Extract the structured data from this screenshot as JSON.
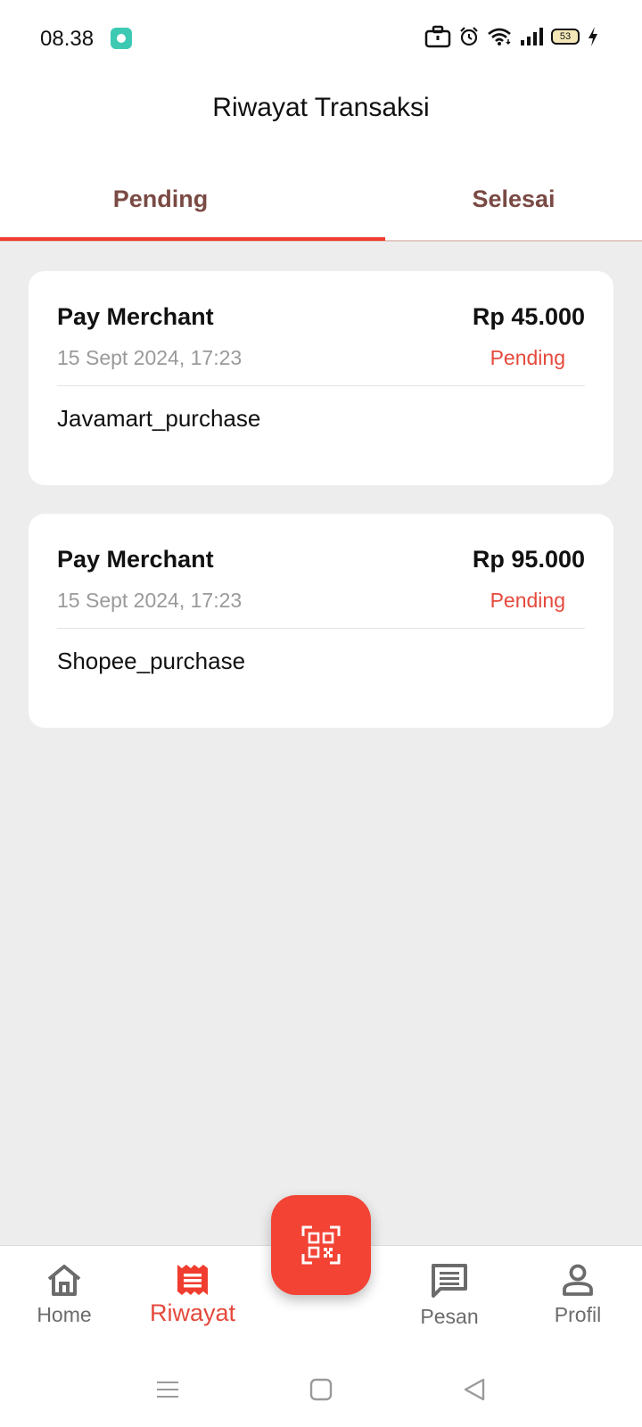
{
  "status_bar": {
    "time": "08.38",
    "battery_level": "53",
    "icons": [
      "app-notification-icon",
      "briefcase-icon",
      "alarm-icon",
      "wifi-icon",
      "signal-icon",
      "battery-icon",
      "charging-icon"
    ]
  },
  "header": {
    "title": "Riwayat Transaksi"
  },
  "tabs": [
    {
      "label": "Pending",
      "active": true
    },
    {
      "label": "Selesai",
      "active": false
    }
  ],
  "transactions": [
    {
      "title": "Pay Merchant",
      "amount": "Rp 45.000",
      "date": "15 Sept 2024, 17:23",
      "status": "Pending",
      "description": "Javamart_purchase"
    },
    {
      "title": "Pay Merchant",
      "amount": "Rp 95.000",
      "date": "15 Sept 2024, 17:23",
      "status": "Pending",
      "description": "Shopee_purchase"
    }
  ],
  "bottom_nav": {
    "items": [
      {
        "label": "Home",
        "icon": "home-icon",
        "active": false
      },
      {
        "label": "Riwayat",
        "icon": "receipt-icon",
        "active": true
      },
      {
        "label": "Pesan",
        "icon": "message-icon",
        "active": false
      },
      {
        "label": "Profil",
        "icon": "person-icon",
        "active": false
      }
    ],
    "fab_icon": "qr-scan-icon"
  },
  "system_nav": [
    "menu-icon",
    "home-square-icon",
    "back-icon"
  ],
  "colors": {
    "accent": "#f24335",
    "status_pending": "#e5493c",
    "tab_text": "#7a4a44",
    "background": "#ededed"
  }
}
